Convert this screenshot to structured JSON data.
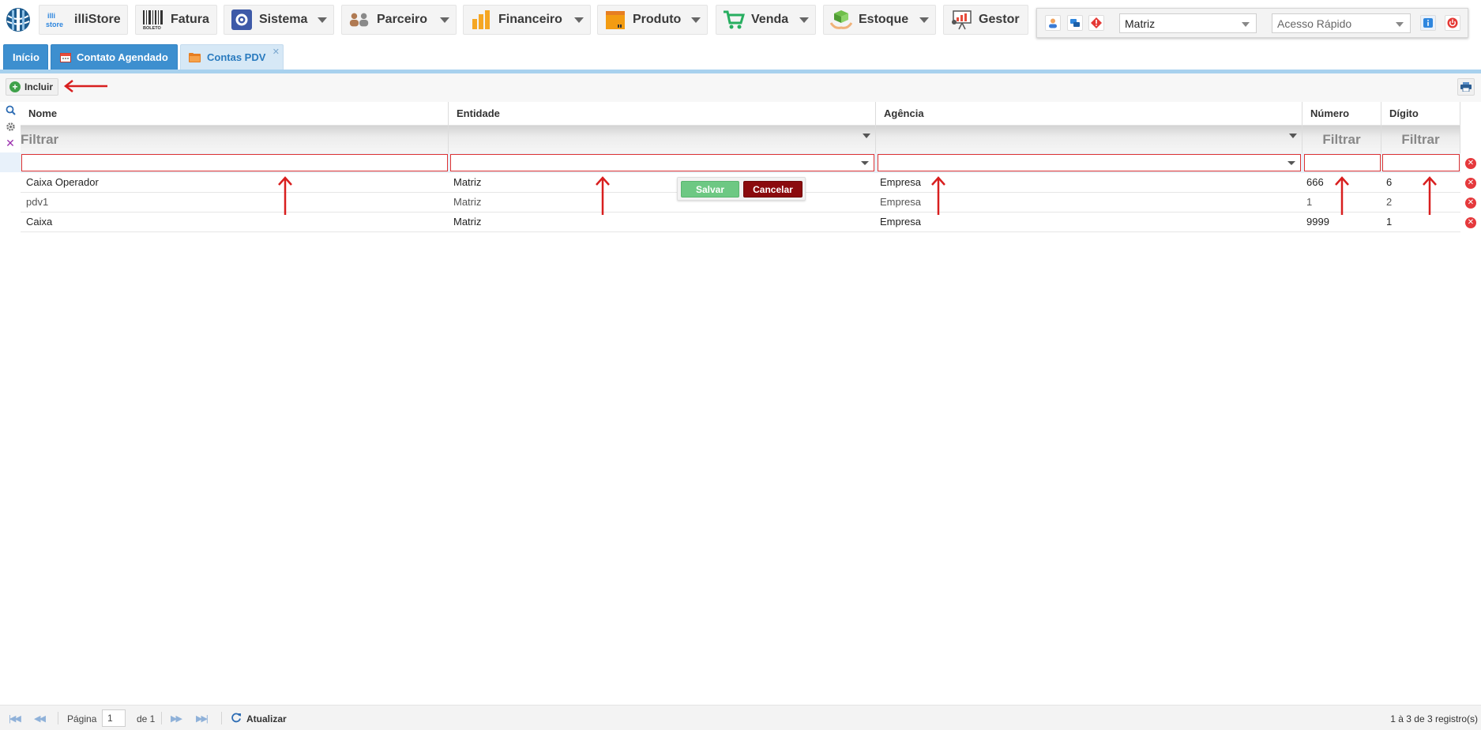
{
  "menu": {
    "items": [
      {
        "label": "illiStore",
        "has_caret": false
      },
      {
        "label": "Fatura",
        "has_caret": false
      },
      {
        "label": "Sistema",
        "has_caret": true
      },
      {
        "label": "Parceiro",
        "has_caret": true
      },
      {
        "label": "Financeiro",
        "has_caret": true
      },
      {
        "label": "Produto",
        "has_caret": true
      },
      {
        "label": "Venda",
        "has_caret": true
      },
      {
        "label": "Estoque",
        "has_caret": true
      },
      {
        "label": "Gestor",
        "has_caret": false
      }
    ],
    "store_logo_text": "illi store",
    "boleto_text": "BOLETO"
  },
  "header_right": {
    "company_select": "Matriz",
    "quick_access_placeholder": "Acesso Rápido"
  },
  "tabs": [
    {
      "label": "Início",
      "active": false
    },
    {
      "label": "Contato Agendado",
      "active": false
    },
    {
      "label": "Contas PDV",
      "active": true
    }
  ],
  "toolbar": {
    "add_label": "Incluir"
  },
  "grid": {
    "columns": [
      {
        "label": "Nome",
        "filter_label": "Filtrar"
      },
      {
        "label": "Entidade",
        "filter_label": ""
      },
      {
        "label": "Agência",
        "filter_label": ""
      },
      {
        "label": "Número",
        "filter_label": "Filtrar"
      },
      {
        "label": "Dígito",
        "filter_label": "Filtrar"
      }
    ],
    "rows": [
      {
        "nome": "Caixa Operador",
        "entidade": "Matriz",
        "agencia": "Empresa",
        "numero": "666",
        "digito": "6"
      },
      {
        "nome": "pdv1",
        "entidade": "Matriz",
        "agencia": "Empresa",
        "numero": "1",
        "digito": "2"
      },
      {
        "nome": "Caixa",
        "entidade": "Matriz",
        "agencia": "Empresa",
        "numero": "9999",
        "digito": "1"
      }
    ]
  },
  "row_editor": {
    "save_label": "Salvar",
    "cancel_label": "Cancelar"
  },
  "pager": {
    "page_label": "Página",
    "page_value": "1",
    "of_label": "de 1",
    "refresh_label": "Atualizar",
    "summary": "1 à 3 de 3 registro(s)"
  },
  "colors": {
    "tab_blue": "#3d8fcf",
    "save_green": "#6dc883",
    "cancel_red": "#8b0b0e",
    "annotation_red": "#d81f1f"
  }
}
